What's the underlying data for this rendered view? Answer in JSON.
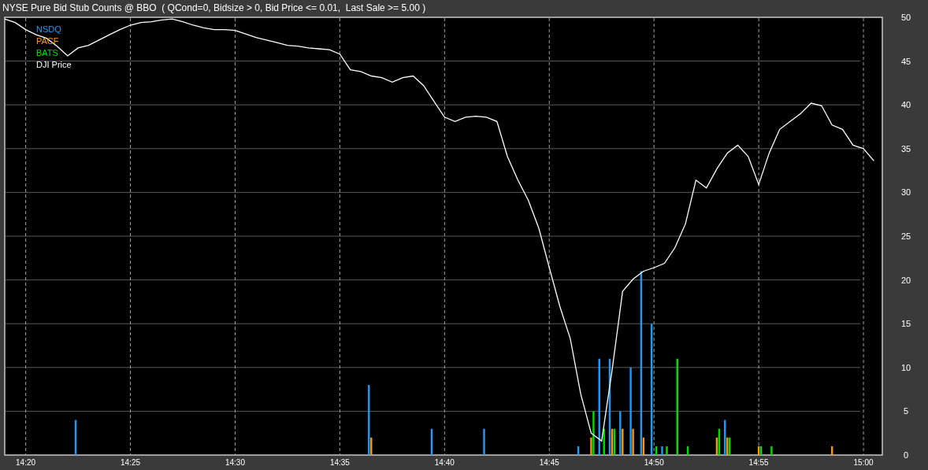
{
  "title": "NYSE Pure Bid Stub Counts @ BBO  ( QCond=0, Bidsize > 0, Bid Price <= 0.01,  Last Sale >= 5.00 )",
  "chart": {
    "chart_data": {
      "type": "bar",
      "stacked": false,
      "grid": true,
      "ylim": [
        0,
        50
      ],
      "yticks": [
        0,
        5,
        10,
        15,
        20,
        25,
        30,
        35,
        40,
        45,
        50
      ],
      "categories": [
        null,
        null,
        "14:20",
        null,
        null,
        null,
        null,
        null,
        null,
        null,
        null,
        null,
        "14:25",
        null,
        null,
        null,
        null,
        null,
        null,
        null,
        null,
        null,
        "14:30",
        null,
        null,
        null,
        null,
        null,
        null,
        null,
        null,
        null,
        "14:35",
        null,
        null,
        null,
        null,
        null,
        null,
        null,
        null,
        null,
        "14:40",
        null,
        null,
        null,
        null,
        null,
        null,
        null,
        null,
        null,
        "14:45",
        null,
        null,
        null,
        null,
        null,
        null,
        null,
        null,
        null,
        "14:50",
        null,
        null,
        null,
        null,
        null,
        null,
        null,
        null,
        null,
        "14:55",
        null,
        null,
        null,
        null,
        null,
        null,
        null,
        null,
        null,
        "15:00",
        null
      ],
      "series": [
        {
          "name": "NSDQ",
          "type": "bar",
          "color": "#1a9cff",
          "values": [
            null,
            null,
            null,
            null,
            null,
            null,
            null,
            4,
            null,
            null,
            null,
            null,
            null,
            null,
            null,
            null,
            null,
            null,
            null,
            null,
            null,
            null,
            null,
            null,
            null,
            null,
            null,
            null,
            null,
            null,
            null,
            null,
            null,
            null,
            null,
            8,
            null,
            null,
            null,
            null,
            null,
            3,
            null,
            null,
            null,
            null,
            3,
            null,
            null,
            null,
            null,
            null,
            null,
            null,
            null,
            1,
            null,
            11,
            11,
            5,
            10,
            21,
            15,
            1,
            null,
            null,
            null,
            null,
            null,
            4,
            null,
            null,
            null,
            null,
            null,
            null,
            null,
            null,
            null,
            null,
            null,
            null,
            null,
            null
          ]
        },
        {
          "name": "PACF",
          "type": "bar",
          "color": "#ff9900",
          "values": [
            null,
            null,
            null,
            null,
            null,
            null,
            null,
            null,
            null,
            null,
            null,
            null,
            null,
            null,
            null,
            null,
            null,
            null,
            null,
            null,
            null,
            null,
            null,
            null,
            null,
            null,
            null,
            null,
            null,
            null,
            null,
            null,
            null,
            null,
            null,
            2,
            null,
            null,
            null,
            null,
            null,
            null,
            null,
            null,
            null,
            null,
            null,
            null,
            null,
            null,
            null,
            null,
            null,
            null,
            null,
            null,
            2,
            null,
            3,
            3,
            3,
            2,
            null,
            null,
            null,
            null,
            null,
            null,
            2,
            2,
            null,
            null,
            1,
            null,
            null,
            null,
            null,
            null,
            null,
            1,
            null,
            null,
            null,
            null
          ]
        },
        {
          "name": "BATS",
          "type": "bar",
          "color": "#00e000",
          "values": [
            null,
            null,
            null,
            null,
            null,
            null,
            null,
            null,
            null,
            null,
            null,
            null,
            null,
            null,
            null,
            null,
            null,
            null,
            null,
            null,
            null,
            null,
            null,
            null,
            null,
            null,
            null,
            null,
            null,
            null,
            null,
            null,
            null,
            null,
            null,
            null,
            null,
            null,
            null,
            null,
            null,
            null,
            null,
            null,
            null,
            null,
            null,
            null,
            null,
            null,
            null,
            null,
            null,
            null,
            null,
            null,
            5,
            3,
            3,
            null,
            null,
            null,
            1,
            1,
            11,
            1,
            null,
            null,
            3,
            2,
            null,
            null,
            1,
            1,
            null,
            null,
            null,
            null,
            null,
            null,
            null,
            null,
            null,
            null
          ]
        },
        {
          "name": "DJI Price",
          "type": "line",
          "color": "#ffffff",
          "values": [
            49.8,
            49.4,
            48.6,
            48.0,
            47.6,
            46.7,
            45.6,
            46.5,
            46.8,
            47.4,
            48.0,
            48.6,
            49.1,
            49.4,
            49.5,
            49.7,
            49.8,
            49.5,
            49.1,
            48.8,
            48.6,
            48.6,
            48.5,
            48.1,
            47.7,
            47.4,
            47.1,
            46.8,
            46.7,
            46.5,
            46.4,
            46.3,
            45.8,
            44.0,
            43.8,
            43.3,
            43.1,
            42.6,
            43.1,
            43.3,
            42.2,
            40.4,
            38.6,
            38.1,
            38.6,
            38.7,
            38.6,
            38.1,
            34.1,
            31.4,
            29.1,
            25.9,
            21.4,
            17.0,
            13.3,
            7.0,
            2.5,
            1.6,
            9.7,
            18.7,
            20.1,
            21.0,
            21.4,
            21.9,
            23.7,
            26.4,
            31.4,
            30.5,
            32.7,
            34.5,
            35.4,
            34.1,
            30.9,
            34.5,
            37.2,
            38.1,
            39.0,
            40.2,
            39.9,
            37.7,
            37.2,
            35.4,
            35.0,
            33.6
          ]
        }
      ]
    }
  }
}
